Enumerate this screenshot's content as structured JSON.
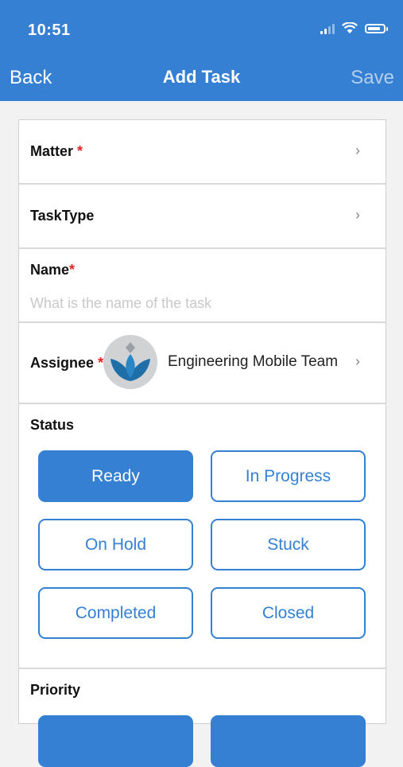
{
  "status_bar": {
    "time": "10:51"
  },
  "nav": {
    "back": "Back",
    "title": "Add Task",
    "save": "Save"
  },
  "form": {
    "matter": {
      "label": "Matter",
      "required": "*",
      "chevron": "›"
    },
    "task_type": {
      "label": "TaskType",
      "chevron": "›"
    },
    "name": {
      "label": "Name",
      "required": "*",
      "placeholder": "What is the name of the task",
      "value": ""
    },
    "assignee": {
      "label": "Assignee",
      "required": "*",
      "value": "Engineering Mobile Team",
      "chevron": "›"
    },
    "status": {
      "label": "Status",
      "selected": "Ready",
      "options": [
        "Ready",
        "In Progress",
        "On Hold",
        "Stuck",
        "Completed",
        "Closed"
      ]
    },
    "priority": {
      "label": "Priority"
    }
  },
  "colors": {
    "accent": "#3580d2",
    "required": "#e02424"
  }
}
